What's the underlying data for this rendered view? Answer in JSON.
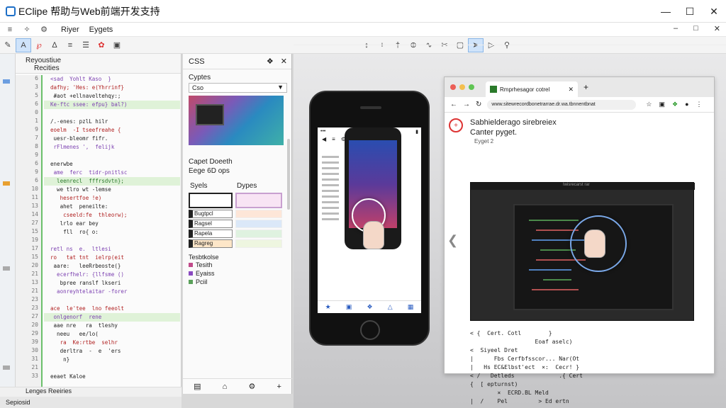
{
  "window": {
    "title": "EClipe 帮助与Web前端开发支持",
    "minimize_icon": "minimize-icon",
    "maximize_icon": "maximize-icon",
    "close_icon": "close-icon"
  },
  "menu": {
    "items": [
      "Riyer",
      "Eygets"
    ],
    "right_minimize": "–",
    "right_restore": "□",
    "right_close": "✕"
  },
  "editor": {
    "tab_title": "Reyoustiue",
    "tab_subtitle": "Recities",
    "footer": "Lenges Reeiries",
    "status": "Sepiosid",
    "line_numbers": [
      "6",
      "3",
      "5",
      "6",
      "0",
      "1",
      "9",
      "7",
      "8",
      "9",
      "6",
      "9",
      "6",
      "10",
      "11",
      "13",
      "14",
      "27",
      "15",
      "19",
      "17",
      "15",
      "20",
      "21",
      "13",
      "21",
      "23",
      "23",
      "27",
      "20",
      "29",
      "39",
      "30",
      "31",
      "21",
      "33"
    ],
    "code_lines": [
      {
        "t": "  <sad  Yohlt Kaso  }",
        "c": "k"
      },
      {
        "t": "  dafhy; 'Hes: e(Yhrrinf}",
        "c": "s"
      },
      {
        "t": "   #aot +ellnaveltehqy:;",
        "c": ""
      },
      {
        "t": "  Ke-ftc ssee: efpu} bal?)",
        "c": "k",
        "hl": true
      },
      {
        "t": "",
        "c": ""
      },
      {
        "t": "  /.-enes: pzlL hilr",
        "c": ""
      },
      {
        "t": "  eoelm  -I tseefreahe {",
        "c": "s"
      },
      {
        "t": "   uesr-bleomr fifr.",
        "c": ""
      },
      {
        "t": "   rFlmenes ',  felijk",
        "c": "k"
      },
      {
        "t": "",
        "c": ""
      },
      {
        "t": "  enerwbe",
        "c": ""
      },
      {
        "t": "   ame  ferc  tidr-pnitlsc",
        "c": "k"
      },
      {
        "t": "    leenrecl  fffrsdvtn};",
        "c": "g",
        "hl": true
      },
      {
        "t": "    we tlro wt -lemse",
        "c": ""
      },
      {
        "t": "     hesertfoe !e)",
        "c": "s"
      },
      {
        "t": "     ahet  peneilte:",
        "c": ""
      },
      {
        "t": "      cseeld:fe  thleorw);",
        "c": "s"
      },
      {
        "t": "     lrlo ear bey",
        "c": ""
      },
      {
        "t": "      fll  ro{ o:",
        "c": ""
      },
      {
        "t": "",
        "c": ""
      },
      {
        "t": "  retl ns  e.  ltlesi",
        "c": "k"
      },
      {
        "t": "  ro   tat tnt  ielrp(eit",
        "c": "s"
      },
      {
        "t": "   aare:   leeRrbeoste(}",
        "c": ""
      },
      {
        "t": "    ecerfhelr: {llfsme ()",
        "c": "k"
      },
      {
        "t": "     bpree ranslf lkseri",
        "c": ""
      },
      {
        "t": "    aonreyhtelaitar -forer",
        "c": "k"
      },
      {
        "t": "",
        "c": ""
      },
      {
        "t": "  ace  le'tee  lno feeolt",
        "c": "s"
      },
      {
        "t": "   onlgenorf  rene",
        "c": "k",
        "hl": true
      },
      {
        "t": "   aae nre   ra  tleshy",
        "c": ""
      },
      {
        "t": "    neeu   ee/lo(",
        "c": ""
      },
      {
        "t": "     ra  Ke:rtbe  selhr",
        "c": "s"
      },
      {
        "t": "     derltra  -  e  'ers",
        "c": ""
      },
      {
        "t": "      n}",
        "c": ""
      },
      {
        "t": "",
        "c": ""
      },
      {
        "t": "  eeaet Kaloe",
        "c": ""
      }
    ]
  },
  "css_panel": {
    "title": "CSS",
    "icons": [
      "pin-icon",
      "close-icon"
    ],
    "section1_label": "Cyptes",
    "dropdown_value": "Cso",
    "section2_label": "Capet Doeeth",
    "section2_sub": "Eege 6D ops",
    "grid_head_left": "Syels",
    "grid_head_right": "Dypes",
    "cells_left": [
      "Bugtpcl",
      "Ragsel",
      "Rapela",
      "Ragreg"
    ],
    "legend_title": "Tesbtkolse",
    "legend": [
      {
        "label": "Tesith",
        "color": "#c04a8a"
      },
      {
        "label": "Eyaiss",
        "color": "#8a4ac0"
      },
      {
        "label": "Pciil",
        "color": "#5aa05a"
      }
    ],
    "footer_icons": [
      "book-icon",
      "home-icon",
      "gear-icon",
      "add-icon"
    ]
  },
  "browser": {
    "tab_title": "Rmprhesagor cotrel",
    "url": "www.sitewrecordbonetrarrae.dr.wa.tbnnentbnat",
    "heading1": "Sabhielderago sirebreiex",
    "heading2": "Canter pyget.",
    "heading3": "Eyget  2",
    "video_caption": "Iwisrecarst rar",
    "code_rows": [
      "< {  Cert. Cotl        }",
      "                   Eoaf aselc)",
      "<  Siyeel Dret",
      "|      Fbs Cerfbfsscor... Nar(Ot",
      "|   Hs EC&Elbst'ect  ×:  Cecr! }",
      "< /   Detleds             .{ Cert",
      "{  [ epturnst)",
      "        ×  ECRD.BL Meld",
      "|  /    Pel         > Ed ertn"
    ]
  },
  "colors": {
    "accent": "#1d6fc7",
    "danger": "#dd3333",
    "highlight": "#dff2d8"
  }
}
